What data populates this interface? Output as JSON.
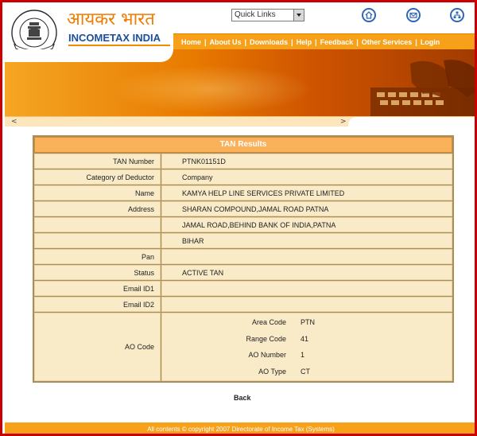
{
  "header": {
    "hindi_title": "आयकर भारत",
    "brand_title": "INCOMETAX INDIA",
    "emblem_caption": "INCOME TAX DEPARTMENT",
    "quick_links": "Quick Links"
  },
  "nav": {
    "items": [
      "Home",
      "About Us",
      "Downloads",
      "Help",
      "Feedback",
      "Other Services",
      "Login"
    ],
    "separator": "|"
  },
  "slider": {
    "left_arrow": "<",
    "right_arrow": ">"
  },
  "results": {
    "title": "TAN Results",
    "rows": [
      {
        "label": "TAN Number",
        "value": "PTNK01151D"
      },
      {
        "label": "Category of Deductor",
        "value": "Company"
      },
      {
        "label": "Name",
        "value": "KAMYA HELP LINE SERVICES PRIVATE LIMITED"
      },
      {
        "label": "Address",
        "value": "SHARAN COMPOUND,JAMAL ROAD PATNA"
      },
      {
        "label": "",
        "value": "JAMAL ROAD,BEHIND BANK OF INDIA,PATNA"
      },
      {
        "label": "",
        "value": "BIHAR"
      },
      {
        "label": "Pan",
        "value": ""
      },
      {
        "label": "Status",
        "value": "ACTIVE TAN"
      },
      {
        "label": "Email ID1",
        "value": ""
      },
      {
        "label": "Email ID2",
        "value": ""
      }
    ],
    "ao_label": "AO Code",
    "ao": [
      {
        "key": "Area Code",
        "value": "PTN"
      },
      {
        "key": "Range Code",
        "value": "41"
      },
      {
        "key": "AO Number",
        "value": "1"
      },
      {
        "key": "AO Type",
        "value": "CT"
      }
    ]
  },
  "back_label": "Back",
  "footer_text": "All contents © copyright 2007 Directorate of Income Tax (Systems)",
  "colors": {
    "frame": "#cc0000",
    "accent_orange": "#f7a11a",
    "brand_blue": "#1a4f9c",
    "row_bg": "#faebc8"
  }
}
